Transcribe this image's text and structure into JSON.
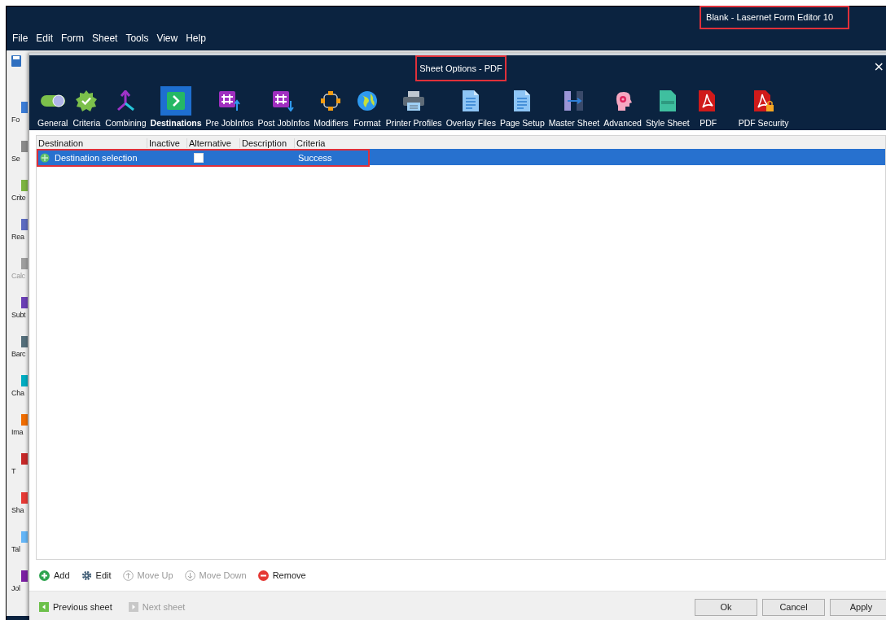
{
  "app_window": {
    "title": "Blank - Lasernet Form Editor 10"
  },
  "menu": [
    "File",
    "Edit",
    "Form",
    "Sheet",
    "Tools",
    "View",
    "Help"
  ],
  "sidebar": {
    "items": [
      "Fo",
      "Se",
      "Crite",
      "Rea",
      "Calc",
      "Subt",
      "Barc",
      "Cha",
      "Ima",
      "T",
      "Sha",
      "Tal",
      "Jol"
    ]
  },
  "dialog": {
    "title": "Sheet Options - PDF",
    "close": "×",
    "tabs": [
      {
        "label": "General",
        "selected": false
      },
      {
        "label": "Criteria",
        "selected": false
      },
      {
        "label": "Combining",
        "selected": false
      },
      {
        "label": "Destinations",
        "selected": true
      },
      {
        "label": "Pre JobInfos",
        "selected": false
      },
      {
        "label": "Post JobInfos",
        "selected": false
      },
      {
        "label": "Modifiers",
        "selected": false
      },
      {
        "label": "Format",
        "selected": false
      },
      {
        "label": "Printer Profiles",
        "selected": false
      },
      {
        "label": "Overlay Files",
        "selected": false
      },
      {
        "label": "Page Setup",
        "selected": false
      },
      {
        "label": "Master Sheet",
        "selected": false
      },
      {
        "label": "Advanced",
        "selected": false
      },
      {
        "label": "Style Sheet",
        "selected": false
      },
      {
        "label": "PDF",
        "selected": false
      },
      {
        "label": "PDF Security",
        "selected": false
      }
    ],
    "table": {
      "columns": [
        "Destination",
        "Inactive",
        "Alternative",
        "Description",
        "Criteria"
      ],
      "rows": [
        {
          "destination": "Destination selection",
          "alternative_checked": false,
          "criteria": "Success",
          "selected": true
        }
      ]
    },
    "actions": [
      {
        "label": "Add",
        "disabled": false
      },
      {
        "label": "Edit",
        "disabled": false
      },
      {
        "label": "Move Up",
        "disabled": true
      },
      {
        "label": "Move Down",
        "disabled": true
      },
      {
        "label": "Remove",
        "disabled": false
      }
    ],
    "nav": [
      {
        "label": "Previous sheet",
        "disabled": false
      },
      {
        "label": "Next sheet",
        "disabled": true
      }
    ],
    "buttons": [
      "Ok",
      "Cancel",
      "Apply"
    ]
  }
}
